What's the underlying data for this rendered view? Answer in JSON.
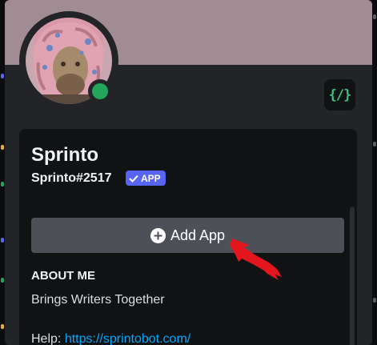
{
  "profile": {
    "display_name": "Sprinto",
    "username": "Sprinto#2517",
    "app_badge": "APP",
    "status": "online",
    "status_color": "#23a55a",
    "banner_color": "#a28c93"
  },
  "profile_badge": {
    "icon": "code-brackets-icon",
    "text": "{/}"
  },
  "add_app": {
    "label": "Add App"
  },
  "about": {
    "title": "ABOUT ME",
    "text": "Brings Writers Together",
    "help_label": "Help:",
    "help_link": "https://sprintobot.com/"
  },
  "colors": {
    "accent": "#5865f2",
    "link": "#00a8fc",
    "button": "#4e5058",
    "annotation_arrow": "#e3161e"
  }
}
